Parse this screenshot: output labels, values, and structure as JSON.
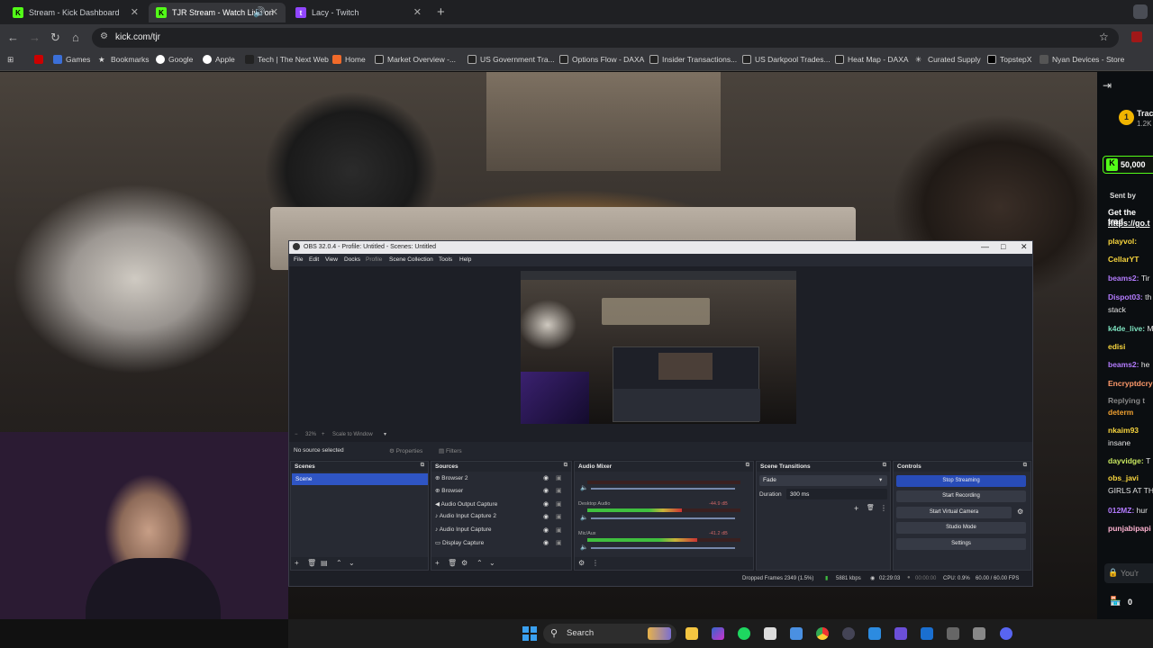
{
  "tabs": [
    {
      "title": "Stream - Kick Dashboard",
      "favicon": "kick-icon",
      "color": "#53fc18",
      "active": false
    },
    {
      "title": "TJR Stream - Watch Live on",
      "favicon": "kick-icon",
      "color": "#53fc18",
      "active": true
    },
    {
      "title": "Lacy - Twitch",
      "favicon": "twitch-icon",
      "color": "#9146ff",
      "active": false
    }
  ],
  "url": "kick.com/tjr",
  "bookmarks": [
    "Games",
    "Bookmarks",
    "Google",
    "Apple",
    "Tech | The Next Web",
    "Home",
    "Market Overview -...",
    "US Government Tra...",
    "Options Flow - DAXA",
    "Insider Transactions...",
    "US Darkpool Trades...",
    "Heat Map - DAXA",
    "Curated Supply",
    "TopstepX",
    "Nyan Devices - Store"
  ],
  "chat": {
    "top_badge": "1",
    "top_name": "Trac",
    "top_count": "1.2K",
    "kicks": "50,000",
    "sent_by": "Sent by",
    "promo": "Get the trad",
    "promo_link": "https://go.t",
    "messages": [
      {
        "user": "playvol:",
        "text": "",
        "color": "#f9d63e"
      },
      {
        "user": "CellarYT",
        "text": "",
        "color": "#f9d63e"
      },
      {
        "user": "beams2:",
        "text": "Tir",
        "color": "#b47cff"
      },
      {
        "user": "Dispot03:",
        "text": "th",
        "color": "#b47cff"
      },
      {
        "user": "",
        "text": "stack",
        "color": "#e4e4e4"
      },
      {
        "user": "k4de_live:",
        "text": "M",
        "color": "#7ee3c0"
      },
      {
        "user": "edisi",
        "text": "",
        "color": "#f9d63e"
      },
      {
        "user": "beams2:",
        "text": "he",
        "color": "#b47cff"
      },
      {
        "user": "Encryptdcry",
        "text": "",
        "color": "#ff9a6b"
      },
      {
        "user": "Replying t",
        "text": "",
        "color": "#888888"
      },
      {
        "user": "determ",
        "text": "",
        "color": "#f0a030"
      },
      {
        "user": "nkaim93",
        "text": "",
        "color": "#f9d63e"
      },
      {
        "user": "",
        "text": "insane",
        "color": "#e4e4e4"
      },
      {
        "user": "dayvidge:",
        "text": "T",
        "color": "#c8e860"
      },
      {
        "user": "obs_javi",
        "text": "",
        "color": "#f9d63e"
      },
      {
        "user": "",
        "text": "GIRLS AT TH",
        "color": "#e4e4e4"
      },
      {
        "user": "012MZ:",
        "text": "hur",
        "color": "#b47cff"
      },
      {
        "user": "punjabipapi",
        "text": "",
        "color": "#ffb3d1"
      }
    ],
    "input_placeholder": "You'r",
    "points": "0"
  },
  "obs": {
    "title": "OBS 32.0.4 - Profile: Untitled - Scenes: Untitled",
    "menu": [
      "File",
      "Edit",
      "View",
      "Docks",
      "Profile",
      "Scene Collection",
      "Tools",
      "Help"
    ],
    "zoom": "32%",
    "scale": "Scale to Window",
    "no_source": "No source selected",
    "properties": "Properties",
    "filters": "Filters",
    "scenes_header": "Scenes",
    "scenes": [
      "Scene"
    ],
    "sources_header": "Sources",
    "sources": [
      "Browser 2",
      "Browser",
      "Audio Output Capture",
      "Audio Input Capture 2",
      "Audio Input Capture",
      "Display Capture"
    ],
    "mixer_header": "Audio Mixer",
    "mixer": [
      {
        "name": "",
        "db": "",
        "level": 0.0
      },
      {
        "name": "Desktop Audio",
        "db": "-44.9 dB",
        "level": 0.62
      },
      {
        "name": "Mic/Aux",
        "db": "-41.2 dB",
        "level": 0.72
      }
    ],
    "transitions_header": "Scene Transitions",
    "transition": "Fade",
    "duration_label": "Duration",
    "duration": "300 ms",
    "controls_header": "Controls",
    "controls": [
      "Stop Streaming",
      "Start Recording",
      "Start Virtual Camera",
      "Studio Mode",
      "Settings"
    ],
    "footer": {
      "dropped": "Dropped Frames 2349 (1.5%)",
      "kbps": "5881 kbps",
      "stream_time": "02:29:03",
      "rec_time": "00:00:00",
      "cpu": "CPU: 0.9%",
      "fps": "60.00 / 60.00 FPS"
    }
  },
  "taskbar": {
    "search": "Search"
  }
}
